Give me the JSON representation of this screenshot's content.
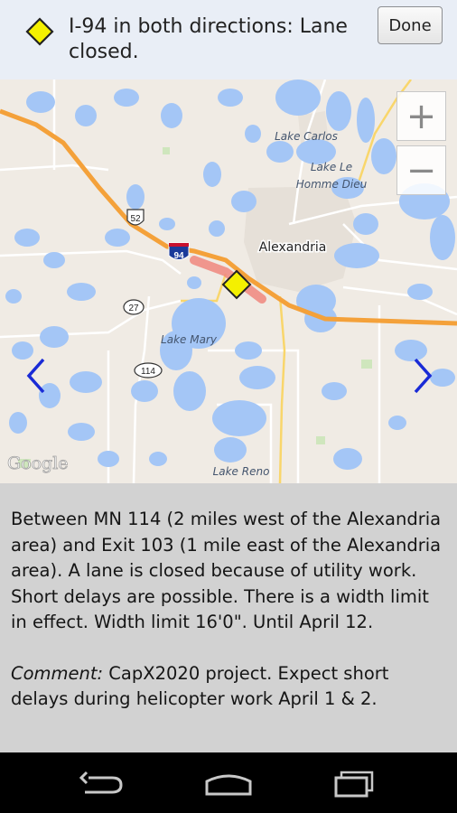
{
  "header": {
    "title": "I-94 in both directions: Lane closed.",
    "done_label": "Done",
    "icon": "yellow-diamond-warning-icon"
  },
  "map": {
    "labels": {
      "lake_carlos": "Lake Carlos",
      "lake_le_homme_dieu_1": "Lake Le",
      "lake_le_homme_dieu_2": "Homme Dieu",
      "alexandria": "Alexandria",
      "lake_mary": "Lake Mary",
      "lake_reno": "Lake Reno",
      "google": "Google"
    },
    "shields": {
      "us52": "52",
      "i94": "94",
      "mn27": "27",
      "mn114": "114"
    },
    "zoom_in": "+",
    "zoom_out": "−",
    "colors": {
      "water": "#a4c6f6",
      "highway": "#f4a13a",
      "closure": "#f0877e",
      "land": "#f0ebe4"
    }
  },
  "description": {
    "main": "Between MN 114 (2 miles west of the Alexandria area) and Exit 103 (1 mile east of the Alexandria area). A lane is closed because of utility work. Short delays are possible. There is a width limit in effect. Width limit 16'0\". Until April 12.",
    "comment_label": "Comment:",
    "comment_text": " CapX2020 project. Expect short delays during helicopter work April 1 & 2."
  },
  "navbar": {
    "back": "back-icon",
    "home": "home-icon",
    "recents": "recent-apps-icon"
  }
}
